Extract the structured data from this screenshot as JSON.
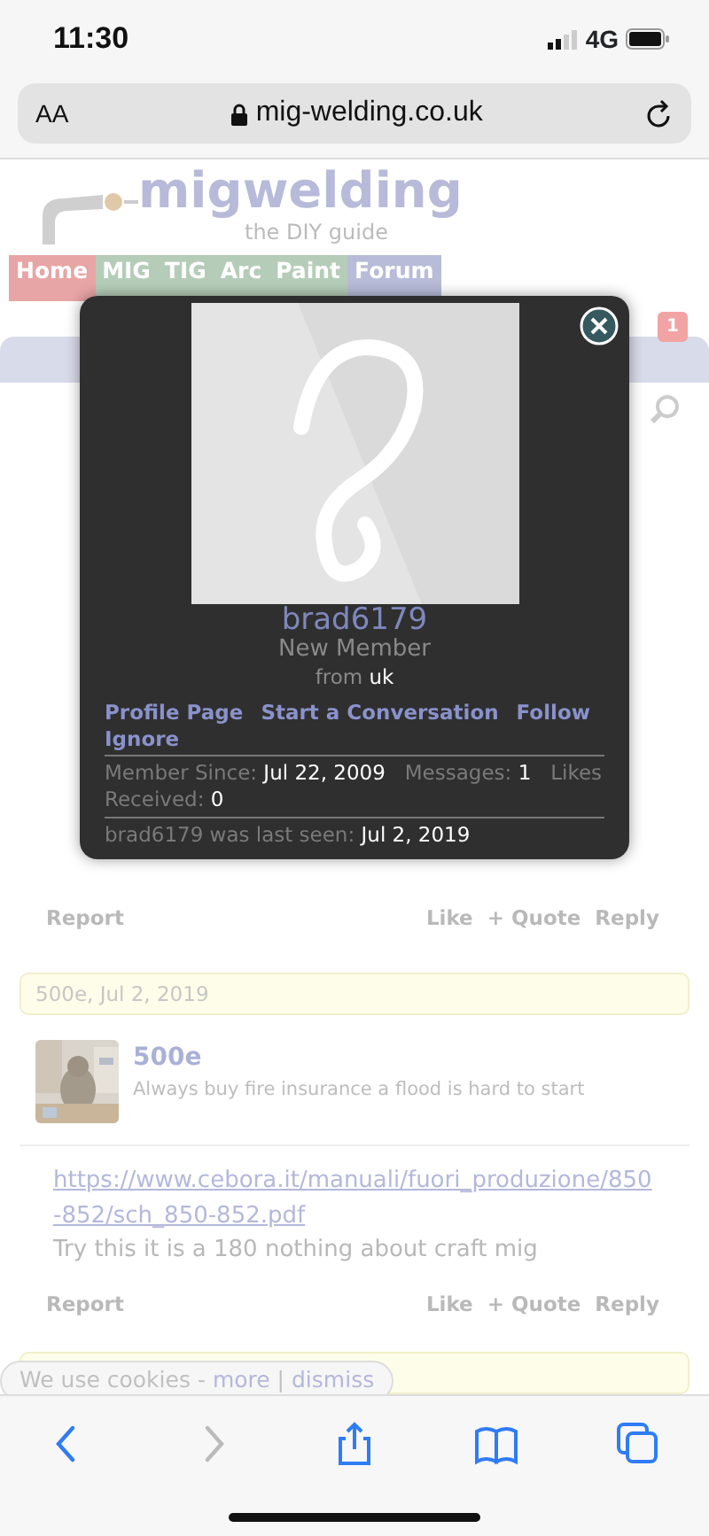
{
  "status_bar": {
    "time": "11:30",
    "network": "4G"
  },
  "address_bar": {
    "text_size_button": "AA",
    "url": "mig-welding.co.uk"
  },
  "site": {
    "logo_title": "migwelding",
    "logo_tagline": "the DIY guide"
  },
  "nav": [
    {
      "label": "Home",
      "color": "#e8a5a5"
    },
    {
      "label": "MIG",
      "color": "#b5cdb8"
    },
    {
      "label": "TIG",
      "color": "#b5cdb8"
    },
    {
      "label": "Arc",
      "color": "#b5cdb8"
    },
    {
      "label": "Paint",
      "color": "#b5cdb8"
    },
    {
      "label": "Forum",
      "color": "#b8bcd8"
    }
  ],
  "alerts_badge": "1",
  "first_post": {
    "actions_left": [
      "Report"
    ],
    "actions_right": [
      "Like",
      "+ Quote",
      "Reply"
    ]
  },
  "second_post": {
    "header": "500e, Jul 2, 2019",
    "username": "500e",
    "signature": "Always buy fire insurance a flood is hard to start",
    "avatar": {
      "kind": "picture"
    },
    "link": "https://www.cebora.it/manuali/fuori_produzione/850-852/sch_850-852.pdf",
    "body": "Try this it is a 180 nothing about craft mig",
    "actions_left": [
      "Report"
    ],
    "actions_right": [
      "Like",
      "+ Quote",
      "Reply"
    ]
  },
  "cookie_notice": {
    "text": "We use cookies -",
    "links": [
      "more",
      "dismiss"
    ],
    "separator": "|"
  },
  "profile_popup": {
    "username": "brad6179",
    "title": "New Member",
    "from_label": "from",
    "location": "uk",
    "links": [
      "Profile Page",
      "Start a Conversation",
      "Follow",
      "Ignore"
    ],
    "stats": [
      {
        "label": "Member Since:",
        "value": "Jul 22, 2009"
      },
      {
        "label": "Messages:",
        "value": "1"
      },
      {
        "label": "Likes Received:",
        "value": "0"
      }
    ],
    "last_seen_label": "brad6179 was last seen:",
    "last_seen": "Jul 2, 2019"
  },
  "toolbar": [
    {
      "kind": "back",
      "disabled": false
    },
    {
      "kind": "forward",
      "disabled": true
    },
    {
      "kind": "share",
      "disabled": false
    },
    {
      "kind": "bookmarks",
      "disabled": false
    },
    {
      "kind": "tabs",
      "disabled": false
    }
  ]
}
